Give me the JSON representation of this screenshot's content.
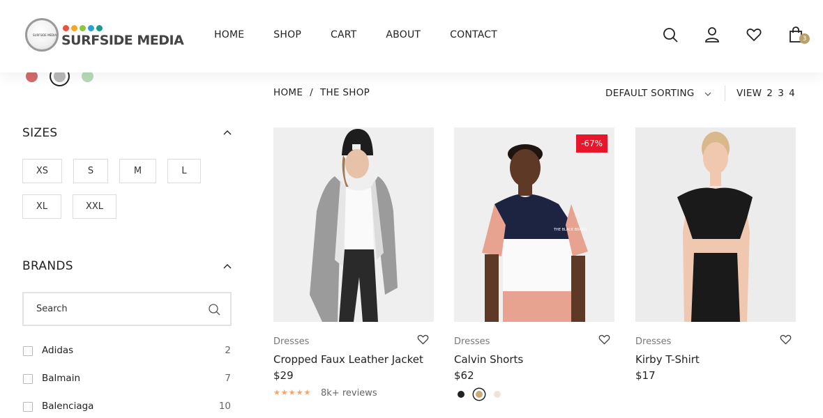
{
  "brand": {
    "name": "SURFSIDE MEDIA",
    "badge_text": "SURFSIDE MEDIA",
    "dot_colors": [
      "#e9523f",
      "#f5a623",
      "#8cc63f",
      "#2f9ed8",
      "#1f9a8a"
    ]
  },
  "nav": [
    {
      "label": "HOME"
    },
    {
      "label": "SHOP"
    },
    {
      "label": "CART"
    },
    {
      "label": "ABOUT"
    },
    {
      "label": "CONTACT"
    }
  ],
  "header_icons": [
    "search-icon",
    "user-icon",
    "heart-icon",
    "shopping-bag-icon"
  ],
  "cart_count": "3",
  "sidebar": {
    "colors": [
      {
        "hex": "#d46b6b",
        "selected": false
      },
      {
        "hex": "#b9b9b9",
        "selected": true
      },
      {
        "hex": "#b7dbb9",
        "selected": false
      }
    ],
    "sizes_title": "SIZES",
    "sizes": [
      "XS",
      "S",
      "M",
      "L",
      "XL",
      "XXL"
    ],
    "brands_title": "BRANDS",
    "brand_search_placeholder": "Search",
    "brands": [
      {
        "name": "Adidas",
        "count": "2"
      },
      {
        "name": "Balmain",
        "count": "7"
      },
      {
        "name": "Balenciaga",
        "count": "10"
      }
    ]
  },
  "breadcrumb": {
    "home": "HOME",
    "sep": "/",
    "current": "THE SHOP"
  },
  "sorting": {
    "label": "DEFAULT SORTING"
  },
  "view": {
    "label": "VIEW",
    "options": [
      "2",
      "3",
      "4"
    ]
  },
  "products": [
    {
      "category": "Dresses",
      "title": "Cropped Faux Leather Jacket",
      "price": "$29",
      "rating_stars": 5,
      "reviews": "8k+ reviews"
    },
    {
      "category": "Dresses",
      "title": "Calvin Shorts",
      "price": "$62",
      "discount": "-67%",
      "colors": [
        {
          "hex": "#222222",
          "selected": false
        },
        {
          "hex": "#c9ab7b",
          "selected": true
        },
        {
          "hex": "#f1e3dc",
          "selected": false
        }
      ]
    },
    {
      "category": "Dresses",
      "title": "Kirby T-Shirt",
      "price": "$17"
    }
  ],
  "accent_colors": {
    "badge": "#b9a16b",
    "discount": "#e6162b",
    "stars": "#f4a46a"
  }
}
